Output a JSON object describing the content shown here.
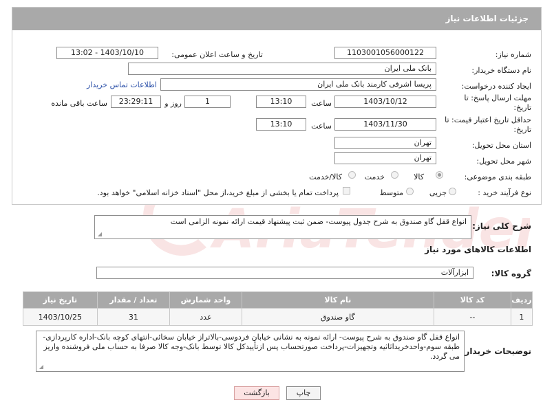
{
  "header": {
    "title": "جزئیات اطلاعات نیاز"
  },
  "fields": {
    "need_number_label": "شماره نیاز:",
    "need_number": "1103001056000122",
    "announce_label": "تاریخ و ساعت اعلان عمومی:",
    "announce_value": "1403/10/10 - 13:02",
    "buyer_org_label": "نام دستگاه خریدار:",
    "buyer_org": "بانک ملی ایران",
    "creator_label": "ایجاد کننده درخواست:",
    "creator": "پریسا اشرفی کارمند بانک ملی ایران",
    "contact_link": "اطلاعات تماس خریدار",
    "deadline_label_1": "مهلت ارسال پاسخ: تا",
    "deadline_label_2": "تاریخ:",
    "deadline_date": "1403/10/12",
    "time_label": "ساعت",
    "deadline_time": "13:10",
    "days_value": "1",
    "days_label": "روز و",
    "remaining_time": "23:29:11",
    "remaining_label": "ساعت باقی مانده",
    "price_validity_label_1": "حداقل تاریخ اعتبار قیمت: تا",
    "price_validity_label_2": "تاریخ:",
    "price_validity_date": "1403/11/30",
    "price_validity_time": "13:10",
    "province_label": "استان محل تحویل:",
    "province": "تهران",
    "city_label": "شهر محل تحویل:",
    "city": "تهران",
    "category_label": "طبقه بندی موضوعی:",
    "category_options": [
      "کالا",
      "خدمت",
      "کالا/خدمت"
    ],
    "process_label": "نوع فرآیند خرید :",
    "process_options": [
      "جزیی",
      "متوسط"
    ],
    "payment_note": "پرداخت تمام یا بخشی از مبلغ خرید،از محل \"اسناد خزانه اسلامی\" خواهد بود."
  },
  "summary": {
    "label": "شرح کلی نیاز:",
    "text": "انواع قفل گاو صندوق به شرح جدول پیوست- ضمن ثبت پیشنهاد قیمت ارائه نمونه الزامی است"
  },
  "goods_section": {
    "title": "اطلاعات کالاهای مورد نیاز",
    "group_label": "گروه کالا:",
    "group_value": "ابزارآلات"
  },
  "table": {
    "headers": [
      "ردیف",
      "کد کالا",
      "نام کالا",
      "واحد شمارش",
      "تعداد / مقدار",
      "تاریخ نیاز"
    ],
    "rows": [
      [
        "1",
        "--",
        "گاو صندوق",
        "عدد",
        "31",
        "1403/10/25"
      ]
    ]
  },
  "buyer_notes": {
    "label": "توضیحات خریدار:",
    "text": "انواع قفل گاو صندوق به شرح پیوست- ارائه نمونه به نشانی خیابان فردوسی-بالاتراز خیابان سخائی-انتهای کوچه بانک-اداره کارپردازی-طبقه سوم-واحدخریداثاثیه وتجهیزات-پرداخت صورتحساب پس ازتأییدکل کالا توسط بانک-وجه کالا صرفا به حساب ملی فروشنده واریز می گردد."
  },
  "buttons": {
    "print": "چاپ",
    "back": "بازگشت"
  },
  "watermark": {
    "text": "AriaTender.net"
  },
  "colors": {
    "header_bg": "#a9a9a9",
    "link": "#2a4fa8",
    "back_button_bg": "#fce4e4",
    "watermark": "#d23b3b"
  }
}
